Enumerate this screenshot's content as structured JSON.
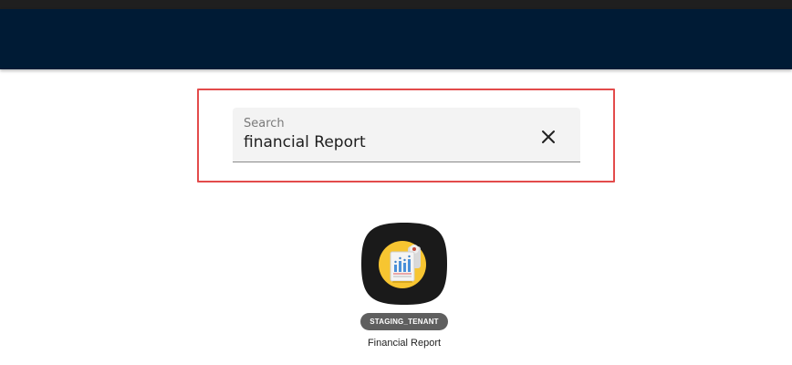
{
  "search": {
    "label": "Search",
    "value": "financial Report"
  },
  "app": {
    "tenant_badge": "STAGING_TENANT",
    "name": "Financial Report",
    "icon": "financial-report-icon"
  },
  "colors": {
    "header": "#001b35",
    "top_strip": "#1f1f1f",
    "highlight_border": "#e34b4b",
    "search_background": "#f3f3f3",
    "badge": "#5f5f5f",
    "icon_circle": "#f7c531",
    "icon_tile": "#1a1a1a"
  }
}
